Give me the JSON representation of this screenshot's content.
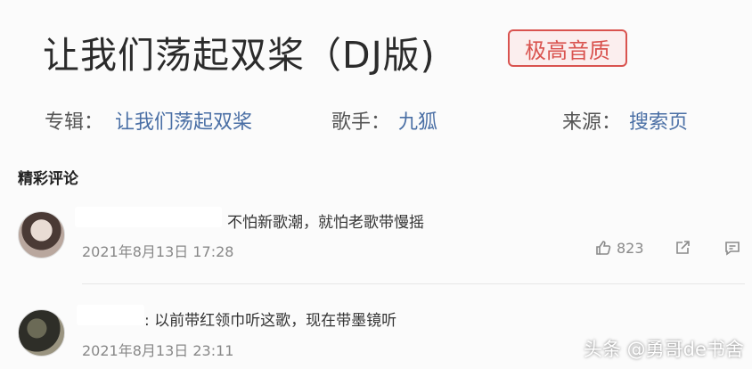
{
  "song": {
    "title": "让我们荡起双桨（DJ版)",
    "quality_badge": "极高音质"
  },
  "meta": {
    "album_label": "专辑：",
    "album_value": "让我们荡起双桨",
    "artist_label": "歌手：",
    "artist_value": "九狐",
    "source_label": "来源：",
    "source_value": "搜索页"
  },
  "comments_section": {
    "title": "精彩评论",
    "comments": [
      {
        "text": "不怕新歌潮，就怕老歌带慢摇",
        "time": "2021年8月13日 17:28",
        "likes": "823"
      },
      {
        "text": ": 以前带红领巾听这歌，现在带墨镜听",
        "time": "2021年8月13日 23:11"
      }
    ]
  },
  "watermark": "头条 @勇哥de书舍",
  "colors": {
    "accent_link": "#4a6fa5",
    "badge_red": "#d9534f"
  }
}
